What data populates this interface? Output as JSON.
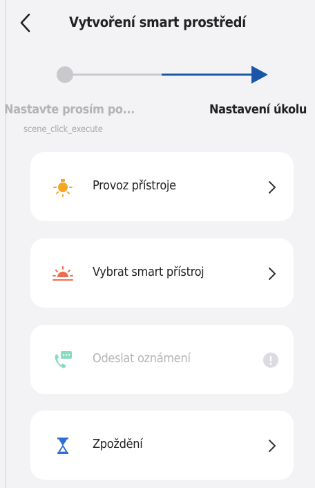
{
  "header": {
    "title": "Vytvoření smart prostředí",
    "back_icon": "chevron-left-icon"
  },
  "stepper": {
    "steps": [
      {
        "label": "Nastavte prosím po...",
        "sub": "scene_click_execute",
        "state": "done"
      },
      {
        "label": "Nastavení úkolu",
        "state": "current"
      }
    ],
    "colors": {
      "inactive": "#c8c8cd",
      "active": "#1a56a8"
    }
  },
  "actions": [
    {
      "label": "Provoz přístroje",
      "icon": "bulb-icon",
      "icon_color": "#f5a623",
      "enabled": true
    },
    {
      "label": "Vybrat smart přístroj",
      "icon": "sunrise-icon",
      "icon_color": "#f26b4f",
      "enabled": true
    },
    {
      "label": "Odeslat oznámení",
      "icon": "phone-message-icon",
      "icon_color": "#27c08e",
      "enabled": false
    },
    {
      "label": "Zpoždění",
      "icon": "hourglass-icon",
      "icon_color": "#2f6fd6",
      "enabled": true
    }
  ]
}
